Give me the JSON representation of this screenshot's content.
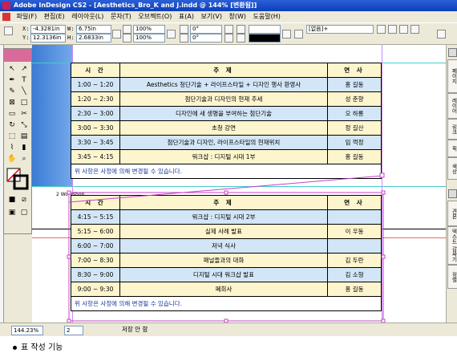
{
  "window": {
    "title": "Adobe InDesign CS2 - [Aesthetics_Bro_K and J.indd @ 144% [변환됨]]"
  },
  "menu": [
    "파일(F)",
    "편집(E)",
    "레이아웃(L)",
    "문자(T)",
    "오브젝트(O)",
    "표(A)",
    "보기(V)",
    "창(W)",
    "도움말(H)"
  ],
  "control": {
    "x_label": "X:",
    "x_value": "-4.3281in",
    "y_label": "Y:",
    "y_value": "12.3136in",
    "w_label": "W:",
    "w_value": "6.75in",
    "h_label": "H:",
    "h_value": "2.6833in",
    "scale_x": "100%",
    "scale_y": "100%",
    "rotate": "0°",
    "shear": "0°",
    "stroke_weight": "",
    "style_select": "[없음]+"
  },
  "status": {
    "zoom": "144.23%",
    "page": "2",
    "save_state": "저장 안 함"
  },
  "caption": "표 작성 기능",
  "table1": {
    "header": [
      "시 간",
      "주 제",
      "연 사"
    ],
    "rows": [
      {
        "time": "1:00 ~ 1:20",
        "topic": "Aesthetics 청단기술 + 라이프스타일 + 디자인 행사 환영사",
        "speaker": "홍 길동"
      },
      {
        "time": "1:20 ~ 2:30",
        "topic": "첨단기술과 디자인의 현재 추세",
        "speaker": "성 춘향"
      },
      {
        "time": "2:30 ~ 3:00",
        "topic": "디자인에 새 생명을 부여하는 첨단기술",
        "speaker": "오 하롱"
      },
      {
        "time": "3:00 ~ 3:30",
        "topic": "초청 강연",
        "speaker": "정 길산"
      },
      {
        "time": "3:30 ~ 3:45",
        "topic": "첨단기술과 디자인, 라이프스타일의 현재위치",
        "speaker": "임 꺽정"
      },
      {
        "time": "3:45 ~ 4:15",
        "topic": "워크샵 : 디지털 시대 1부",
        "speaker": "홍 길동"
      }
    ],
    "note": "위 사항은 사정에 의해 변경될 수 있습니다."
  },
  "table2": {
    "label": "2 Workshop",
    "header": [
      "시 간",
      "주 제",
      "연 사"
    ],
    "rows": [
      {
        "time": "4:15 ~ 5:15",
        "topic": "워크샵 : 디지털 시대 2부",
        "speaker": ""
      },
      {
        "time": "5:15 ~ 6:00",
        "topic": "실제 사례 발표",
        "speaker": "이 우동"
      },
      {
        "time": "6:00 ~ 7:00",
        "topic": "저녁 식사",
        "speaker": ""
      },
      {
        "time": "7:00 ~ 8:30",
        "topic": "패널들과의 대화",
        "speaker": "김 두란"
      },
      {
        "time": "8:30 ~ 9:00",
        "topic": "디지털 시대 워크샵 발표",
        "speaker": "김 소형"
      },
      {
        "time": "9:00 ~ 9:30",
        "topic": "폐회사",
        "speaker": "홍 길동"
      }
    ],
    "note": "위 사항은 사정에 의해 변경될 수 있습니다."
  },
  "panels": [
    "페이지",
    "레이어",
    "링크",
    "획",
    "색상",
    "견본",
    "텍스트 감싸기",
    "정렬"
  ],
  "colors": {
    "title_bar": "#0b3fb8",
    "row_blue": "#d3e6f7",
    "row_yellow": "#fdf5cd",
    "selection": "#c840c8"
  }
}
